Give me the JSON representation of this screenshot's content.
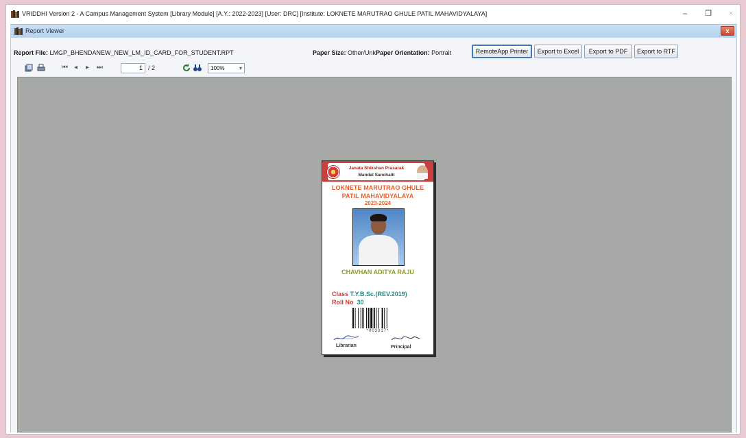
{
  "window": {
    "title": "VRIDDHI Version 2 - A Campus Management System [Library Module] [A.Y.: 2022-2023] [User: DRC] [Institute: LOKNETE MARUTRAO GHULE PATIL MAHAVIDYALAYA]",
    "minimize": "–",
    "maximize": "❐",
    "close": "×"
  },
  "viewer": {
    "title": "Report Viewer",
    "close": "x"
  },
  "info": {
    "report_file_label": "Report File:",
    "report_file": "LMGP_BHENDANEW_NEW_LM_ID_CARD_FOR_STUDENT.RPT",
    "paper_size_label": "Paper Size:",
    "paper_size": "Other/Unk",
    "orientation_label": "Paper Orientation:",
    "orientation": "Portrait"
  },
  "buttons": {
    "remote_printer": "RemoteApp Printer",
    "export_excel": "Export to Excel",
    "export_pdf": "Export to PDF",
    "export_rtf": "Export to RTF"
  },
  "toolbar": {
    "first": "⏮",
    "prev": "◂",
    "next": "▸",
    "last": "⏭",
    "current_page": "1",
    "total_pages": "/ 2",
    "zoom": "100%"
  },
  "card": {
    "trust_line1": "Janata Shikshan Prasarak",
    "trust_line2": "Mandal Sanchalit",
    "college_line1": "LOKNETE MARUTRAO GHULE",
    "college_line2": "PATIL MAHAVIDYALAYA",
    "year": "2023-2024",
    "student_name": "CHAVHAN ADITYA RAJU",
    "class_label": "Class",
    "class_value": "T.Y.B.Sc.(REV.2019)",
    "roll_label": "Roll No",
    "roll_value": "30",
    "barcode_text": "*003017*",
    "librarian": "Librarian",
    "principal": "Principal"
  },
  "colors": {
    "canvas": "#a6a9a6",
    "viewer_header": "#c9dff4",
    "card_band": "#c84141",
    "college_text": "#e2612c",
    "name_text": "#8d9b2c"
  }
}
